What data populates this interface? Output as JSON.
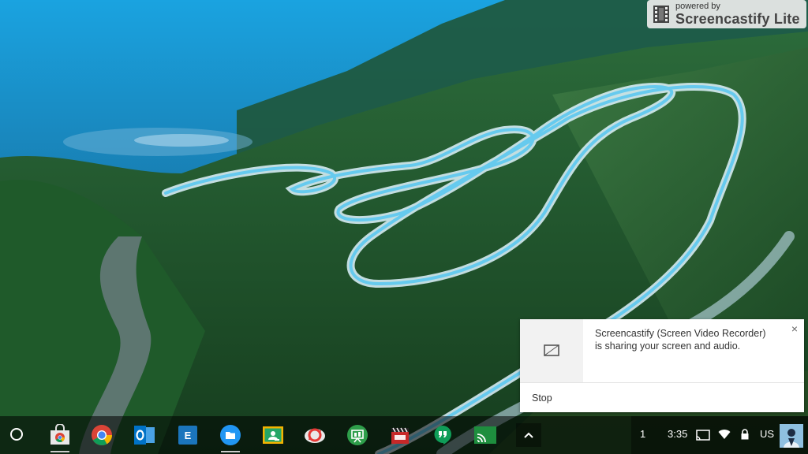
{
  "watermark": {
    "small": "powered by",
    "big": "Screencastify Lite"
  },
  "notification": {
    "message_line1": "Screencastify (Screen Video Recorder)",
    "message_line2": "is sharing your screen and audio.",
    "close_glyph": "×",
    "stop_label": "Stop",
    "icon": "screen-share-icon"
  },
  "shelf": {
    "launcher_icon": "launcher-icon",
    "apps": [
      {
        "name": "chrome-web-store",
        "icon": "web-store-icon"
      },
      {
        "name": "google-chrome",
        "icon": "chrome-icon"
      },
      {
        "name": "outlook",
        "icon": "outlook-icon",
        "letter": "O"
      },
      {
        "name": "evernote",
        "icon": "e-icon",
        "letter": "E"
      },
      {
        "name": "files",
        "icon": "folder-icon"
      },
      {
        "name": "google-classroom",
        "icon": "classroom-icon"
      },
      {
        "name": "sync-app",
        "icon": "sync-icon"
      },
      {
        "name": "slides-app",
        "icon": "presentation-icon"
      },
      {
        "name": "movie-app",
        "icon": "clapper-icon"
      },
      {
        "name": "hangouts",
        "icon": "hangouts-icon"
      },
      {
        "name": "cast-app",
        "icon": "cast-icon"
      }
    ],
    "tray_icon": "chevron-up-icon"
  },
  "status_area": {
    "notification_count": "1",
    "time": "3:35",
    "language": "US",
    "icons": [
      "cast-icon",
      "wifi-icon",
      "lock-icon",
      "avatar"
    ]
  },
  "colors": {
    "chrome_red": "#db4437",
    "chrome_green": "#0f9d58",
    "chrome_yellow": "#f4b400",
    "chrome_blue": "#4285f4",
    "outlook_blue": "#0072c6",
    "files_blue": "#2196f3",
    "classroom_green": "#25a667",
    "hangouts_green": "#0f9d58"
  }
}
